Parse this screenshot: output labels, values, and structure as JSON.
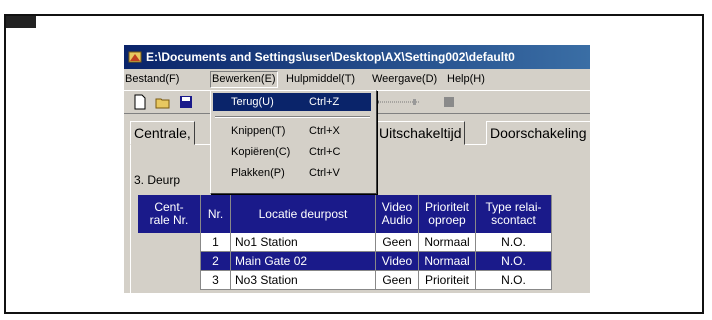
{
  "window": {
    "title": "E:\\Documents and Settings\\user\\Desktop\\AX\\Setting002\\default0"
  },
  "menubar": [
    "Bestand(F)",
    "Bewerken(E)",
    "Hulpmiddel(T)",
    "Weergave(D)",
    "Help(H)"
  ],
  "edit_menu": {
    "items": [
      {
        "label": "Terug(U)",
        "shortcut": "Ctrl+Z",
        "selected": true
      },
      {
        "label": "Knippen(T)",
        "shortcut": "Ctrl+X"
      },
      {
        "label": "Kopiëren(C)",
        "shortcut": "Ctrl+C"
      },
      {
        "label": "Plakken(P)",
        "shortcut": "Ctrl+V"
      }
    ]
  },
  "tabs": [
    "Centrale,",
    "Uitschakeltijd",
    "Doorschakeling"
  ],
  "section_label": "3. Deurp",
  "table": {
    "headers": [
      "Cent-\nrale Nr.",
      "Nr.",
      "Locatie deurpost",
      "Video\nAudio",
      "Prioriteit\noproep",
      "Type relai-\nscontact"
    ],
    "rows": [
      [
        "",
        "1",
        "No1 Station",
        "Geen",
        "Normaal",
        "N.O."
      ],
      [
        "",
        "2",
        "Main Gate 02",
        "Video",
        "Normaal",
        "N.O."
      ],
      [
        "",
        "3",
        "No3 Station",
        "Geen",
        "Prioriteit",
        "N.O."
      ]
    ],
    "selected_row": 1
  },
  "colors": {
    "header_bg": "#1a1a8a",
    "selection": "#0a246a",
    "face": "#d4d0c8"
  },
  "icons": [
    "app-icon",
    "new-file-icon",
    "open-folder-icon",
    "save-icon"
  ]
}
